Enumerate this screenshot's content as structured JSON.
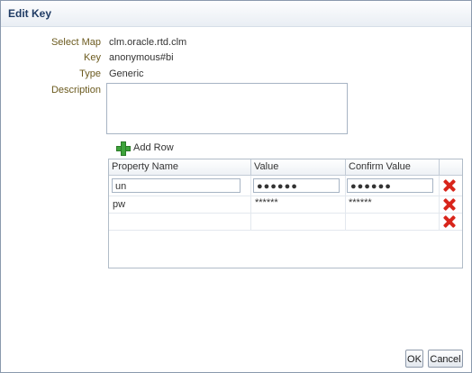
{
  "dialog": {
    "title": "Edit Key"
  },
  "fields": {
    "select_map_label": "Select Map",
    "select_map_value": "clm.oracle.rtd.clm",
    "key_label": "Key",
    "key_value": "anonymous#bi",
    "type_label": "Type",
    "type_value": "Generic",
    "description_label": "Description",
    "description_value": ""
  },
  "add_row_label": "Add Row",
  "table": {
    "columns": [
      "Property Name",
      "Value",
      "Confirm Value"
    ],
    "rows": [
      {
        "name": "un",
        "value": "●●●●●●",
        "confirm": "●●●●●●"
      },
      {
        "name": "pw",
        "value": "******",
        "confirm": "******"
      },
      {
        "name": "",
        "value": "",
        "confirm": ""
      }
    ]
  },
  "buttons": {
    "ok": "OK",
    "cancel": "Cancel"
  },
  "colors": {
    "label": "#6b5a1e",
    "title": "#1f3b64",
    "delete": "#d8251b",
    "add": "#3da33a"
  }
}
